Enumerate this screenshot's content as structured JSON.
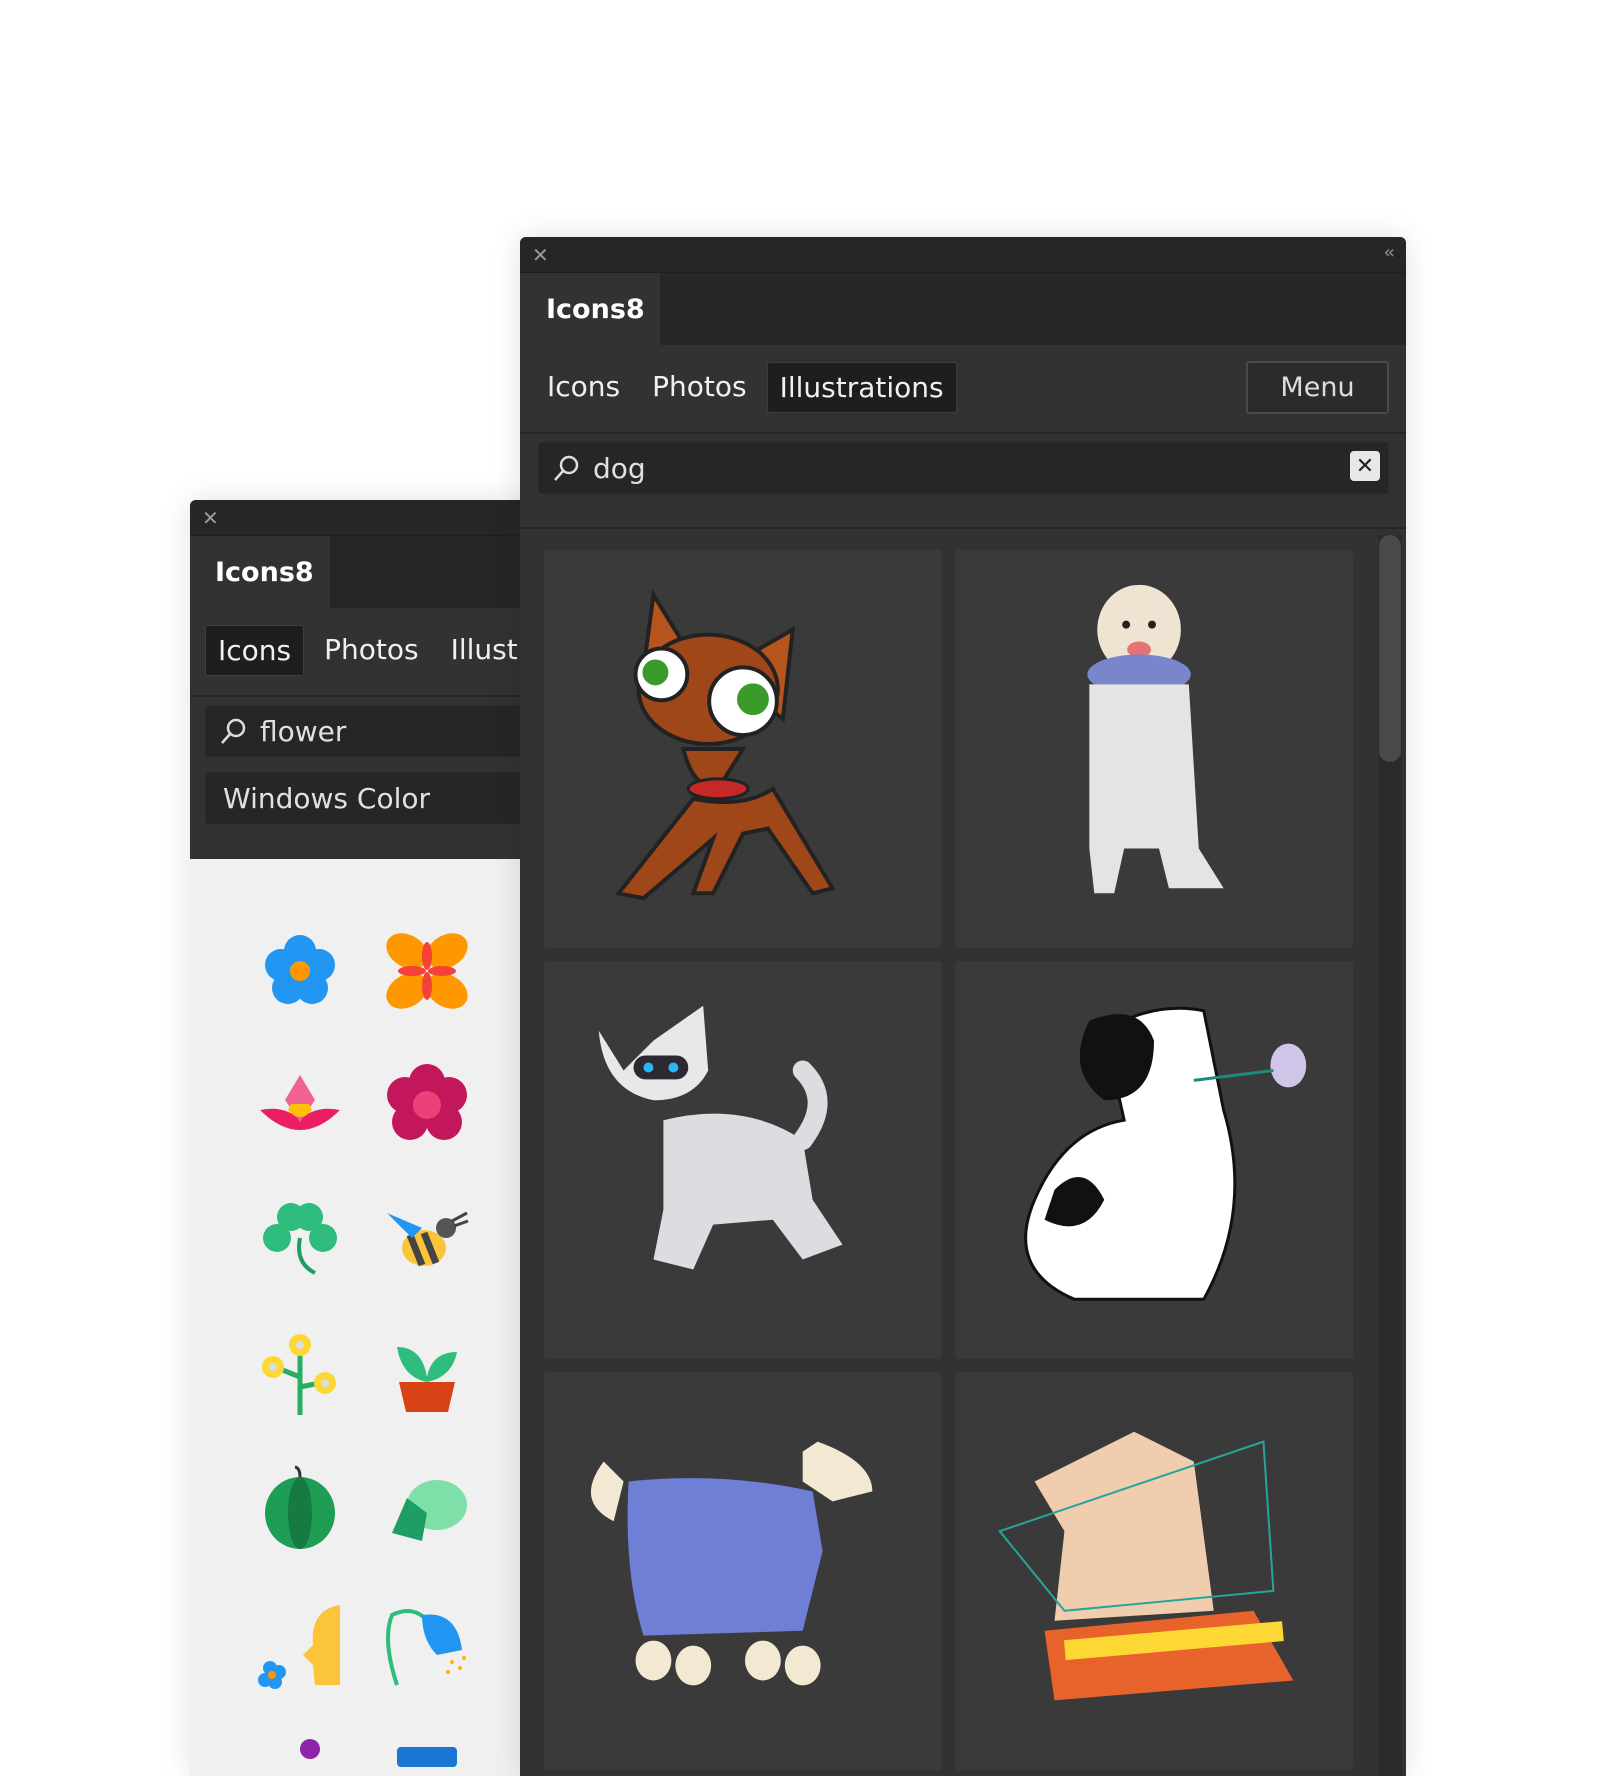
{
  "back_panel": {
    "close_icon": "close-icon",
    "title": "Icons8",
    "tabs": [
      {
        "label": "Icons",
        "active": true
      },
      {
        "label": "Photos",
        "active": false
      },
      {
        "label": "Illustrations",
        "active": false
      }
    ],
    "search": {
      "value": "flower",
      "icon": "search-icon"
    },
    "style_select": {
      "value": "Windows Color"
    },
    "icons": [
      "blue-flower",
      "orange-flower",
      "lotus",
      "red-rose",
      "clover",
      "bee",
      "yellow-flowers",
      "potted-plant",
      "watermelon",
      "hops",
      "smelling-flower",
      "bluebell",
      "violet",
      "watering-can"
    ]
  },
  "front_panel": {
    "close_icon": "close-icon",
    "collapse_icon": "double-chevron-left-icon",
    "title": "Icons8",
    "tabs": [
      {
        "label": "Icons",
        "active": false
      },
      {
        "label": "Photos",
        "active": false
      },
      {
        "label": "Illustrations",
        "active": true
      }
    ],
    "menu_label": "Menu",
    "search": {
      "value": "dog",
      "icon": "search-icon",
      "clear_icon": "clear-icon"
    },
    "results": [
      "cartoon-chihuahua",
      "dog-astronaut-3d",
      "robot-dog-3d",
      "dog-with-rose",
      "dog-in-sweater",
      "dog-with-cone"
    ]
  },
  "colors": {
    "panel": "#323232",
    "header": "#262626",
    "card": "#3a3a3a",
    "icons_bg": "#f0f0f0"
  }
}
